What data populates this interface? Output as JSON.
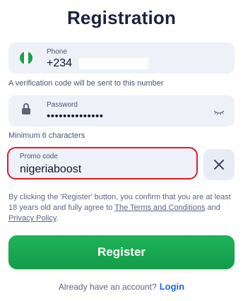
{
  "title": "Registration",
  "phone": {
    "label": "Phone",
    "value": "+234",
    "icon": "nigeria-flag-icon",
    "hint": "A verification code will be sent to this number"
  },
  "password": {
    "label": "Password",
    "value": "••••••••••••••",
    "icon": "lock-icon",
    "toggle_icon": "eye-closed-icon",
    "hint": "Minimum 6 characters"
  },
  "promo": {
    "label": "Promo code",
    "value": "nigeriaboost",
    "clear_icon": "close-icon",
    "highlight_color": "#e11b2a"
  },
  "terms": {
    "prefix": "By clicking the 'Register' button, you confirm that you are at least 18 years old and fully agree to ",
    "terms_link": "The Terms and Conditions",
    "and": " and ",
    "privacy_link": "Privacy Policy",
    "suffix": "."
  },
  "register_button": {
    "label": "Register",
    "color": "#16a951"
  },
  "footer": {
    "text": "Already have an account?",
    "login_link": "Login",
    "link_color": "#1f66e5"
  }
}
